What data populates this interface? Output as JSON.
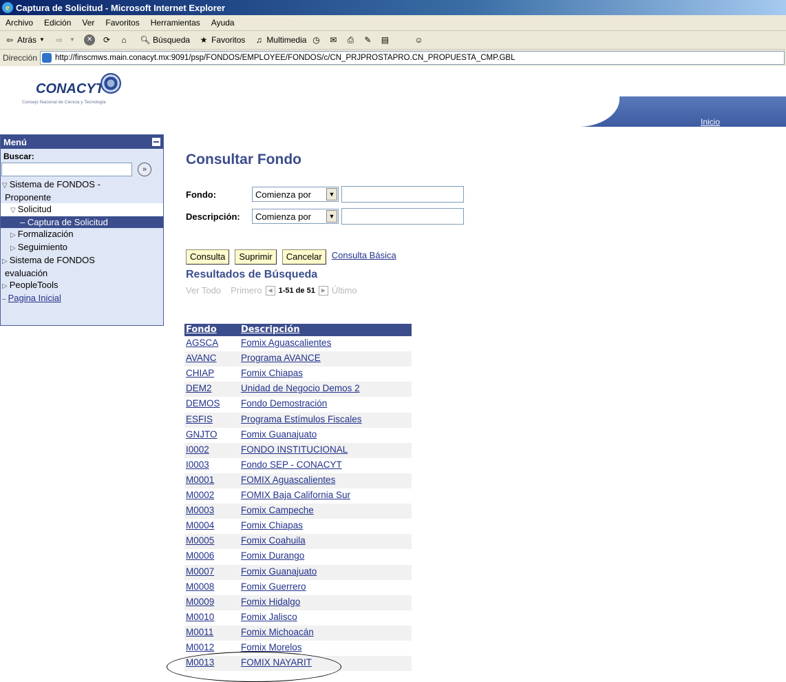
{
  "window": {
    "title": "Captura de Solicitud - Microsoft Internet Explorer"
  },
  "menubar": {
    "items": [
      "Archivo",
      "Edición",
      "Ver",
      "Favoritos",
      "Herramientas",
      "Ayuda"
    ]
  },
  "toolbar": {
    "back": "Atrás",
    "search": "Búsqueda",
    "favorites": "Favoritos",
    "media": "Multimedia"
  },
  "address": {
    "label": "Dirección",
    "url": "http://finscmws.main.conacyt.mx:9091/psp/FONDOS/EMPLOYEE/FONDOS/c/CN_PRJPROSTAPRO.CN_PROPUESTA_CMP.GBL"
  },
  "header": {
    "logo_text": "CONACYT",
    "logo_tagline": "Consejo Nacional de Ciencia y Tecnología",
    "home_link": "Inicio"
  },
  "menu": {
    "title": "Menú",
    "search_label": "Buscar:",
    "items": [
      "Sistema de FONDOS -",
      "Proponente",
      "Solicitud",
      "– Captura de Solicitud",
      "Formalización",
      "Seguimiento",
      "Sistema de FONDOS",
      "evaluación",
      "PeopleTools",
      "Pagina Inicial"
    ]
  },
  "main": {
    "title": "Consultar Fondo",
    "field_fondo_label": "Fondo:",
    "field_desc_label": "Descripción:",
    "operator": "Comienza por",
    "buttons": {
      "consulta": "Consulta",
      "suprimir": "Suprimir",
      "cancelar": "Cancelar",
      "basic_link": "Consulta Básica"
    },
    "results_title": "Resultados de Búsqueda",
    "nav": {
      "ver_todo": "Ver Todo",
      "primero": "Primero",
      "count": "1-51 de 51",
      "ultimo": "Último"
    },
    "columns": [
      "Fondo",
      "Descripción"
    ],
    "rows": [
      [
        "AGSCA",
        "Fomix Aguascalientes"
      ],
      [
        "AVANC",
        "Programa AVANCE"
      ],
      [
        "CHIAP",
        "Fomix Chiapas"
      ],
      [
        "DEM2",
        "Unidad de Negocio Demos 2"
      ],
      [
        "DEMOS",
        "Fondo Demostración"
      ],
      [
        "ESFIS",
        "Programa Estímulos Fiscales"
      ],
      [
        "GNJTO",
        "Fomix Guanajuato"
      ],
      [
        "I0002",
        "FONDO INSTITUCIONAL"
      ],
      [
        "I0003",
        "Fondo SEP - CONACYT"
      ],
      [
        "M0001",
        "FOMIX Aguascalientes"
      ],
      [
        "M0002",
        "FOMIX Baja California Sur"
      ],
      [
        "M0003",
        "Fomix Campeche"
      ],
      [
        "M0004",
        "Fomix Chiapas"
      ],
      [
        "M0005",
        "Fomix Coahuila"
      ],
      [
        "M0006",
        "Fomix Durango"
      ],
      [
        "M0007",
        "Fomix Guanajuato"
      ],
      [
        "M0008",
        "Fomix Guerrero"
      ],
      [
        "M0009",
        "Fomix Hidalgo"
      ],
      [
        "M0010",
        "Fomix Jalisco"
      ],
      [
        "M0011",
        "Fomix Michoacán"
      ],
      [
        "M0012",
        "Fomix Morelos"
      ],
      [
        "M0013",
        "FOMIX NAYARIT"
      ]
    ]
  },
  "colors": {
    "brand": "#3b4d8c",
    "button_bg": "#fefccc",
    "link": "#22328b"
  }
}
